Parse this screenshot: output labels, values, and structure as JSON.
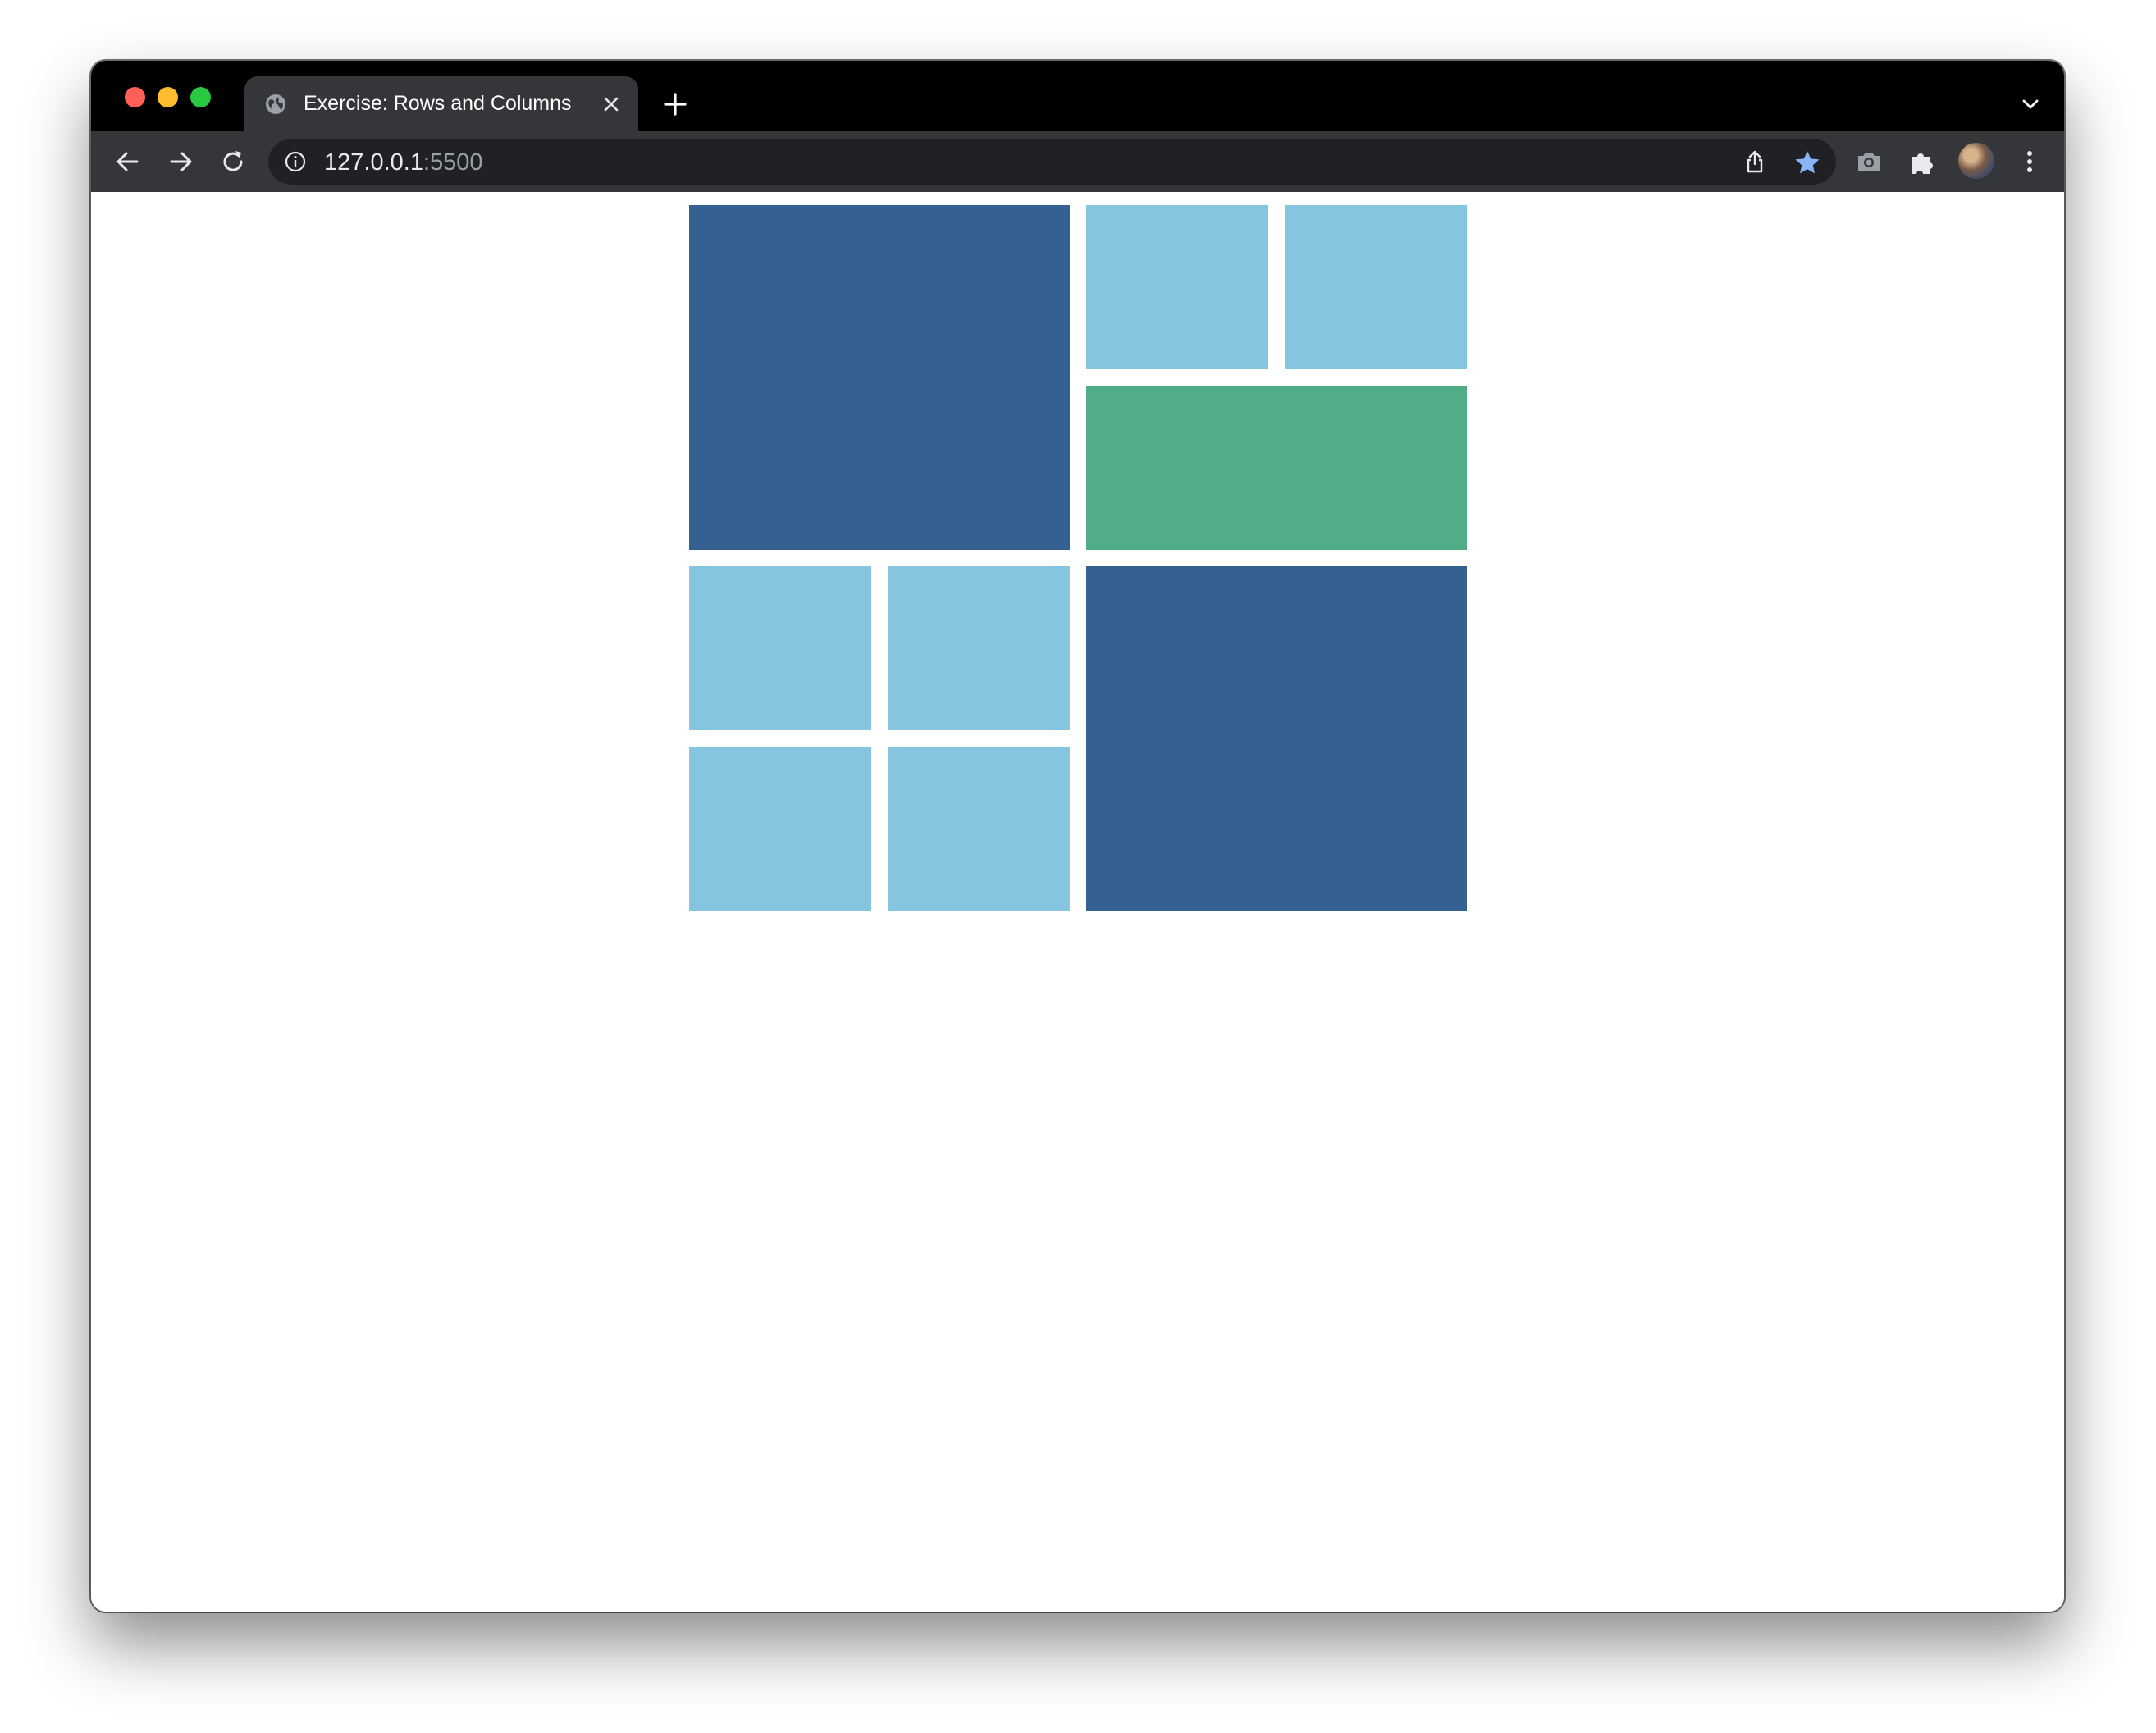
{
  "browser": {
    "tab": {
      "title": "Exercise: Rows and Columns",
      "favicon": "globe-icon"
    },
    "address_bar": {
      "host": "127.0.0.1",
      "port": ":5500"
    },
    "icons": {
      "back": "arrow-left-icon",
      "forward": "arrow-right-icon",
      "reload": "reload-icon",
      "site_info": "info-icon",
      "share": "share-icon",
      "bookmark": "star-icon",
      "screenshot": "camera-icon",
      "extensions": "puzzle-icon",
      "menu": "kebab-menu-icon",
      "tab_search": "chevron-down-icon",
      "new_tab": "plus-icon",
      "close_tab": "close-icon"
    },
    "colors": {
      "traffic_red": "#ff5f57",
      "traffic_yellow": "#febc2e",
      "traffic_green": "#28c840",
      "star_accent": "#8ab4f8"
    }
  },
  "page": {
    "colors": {
      "dark_blue": "#346192",
      "light_blue": "#85c5e0",
      "green": "#50ad87"
    },
    "boxes": [
      {
        "name": "box-large-top-left",
        "color": "dark"
      },
      {
        "name": "box-small-top-1",
        "color": "light"
      },
      {
        "name": "box-small-top-2",
        "color": "light"
      },
      {
        "name": "box-wide-green",
        "color": "green"
      },
      {
        "name": "box-small-bottom-1",
        "color": "light"
      },
      {
        "name": "box-small-bottom-2",
        "color": "light"
      },
      {
        "name": "box-small-bottom-3",
        "color": "light"
      },
      {
        "name": "box-small-bottom-4",
        "color": "light"
      },
      {
        "name": "box-large-bottom-right",
        "color": "dark"
      }
    ]
  }
}
